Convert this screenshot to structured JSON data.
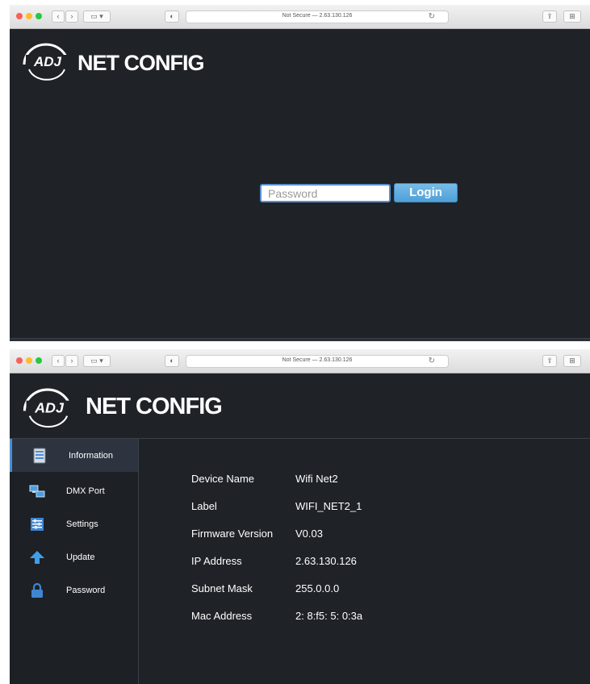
{
  "login_screen": {
    "browser": {
      "url": "Not Secure — 2.63.130.126"
    },
    "brand": {
      "title": "NET CONFIG"
    },
    "password_field": {
      "placeholder": "Password",
      "value": ""
    },
    "login_button": {
      "label": "Login"
    }
  },
  "config_screen": {
    "browser": {
      "url": "Not Secure — 2.63.130.126"
    },
    "brand": {
      "title": "NET CONFIG"
    },
    "sidebar": {
      "items": [
        {
          "label": "Information",
          "icon": "information-icon",
          "active": true
        },
        {
          "label": "DMX Port",
          "icon": "dmx-port-icon",
          "active": false
        },
        {
          "label": "Settings",
          "icon": "settings-icon",
          "active": false
        },
        {
          "label": "Update",
          "icon": "update-arrow-icon",
          "active": false
        },
        {
          "label": "Password",
          "icon": "lock-icon",
          "active": false
        }
      ]
    },
    "information": {
      "rows": [
        {
          "label": "Device Name",
          "value": "Wifi Net2"
        },
        {
          "label": "Label",
          "value": "WIFI_NET2_1"
        },
        {
          "label": "Firmware Version",
          "value": "V0.03"
        },
        {
          "label": "IP Address",
          "value": "2.63.130.126"
        },
        {
          "label": "Subnet Mask",
          "value": "255.0.0.0"
        },
        {
          "label": "Mac Address",
          "value": "2: 8:f5: 5: 0:3a"
        }
      ]
    }
  },
  "colors": {
    "page_background": "#1f2227",
    "accent_blue": "#4f9fd6",
    "text": "#ffffff"
  }
}
